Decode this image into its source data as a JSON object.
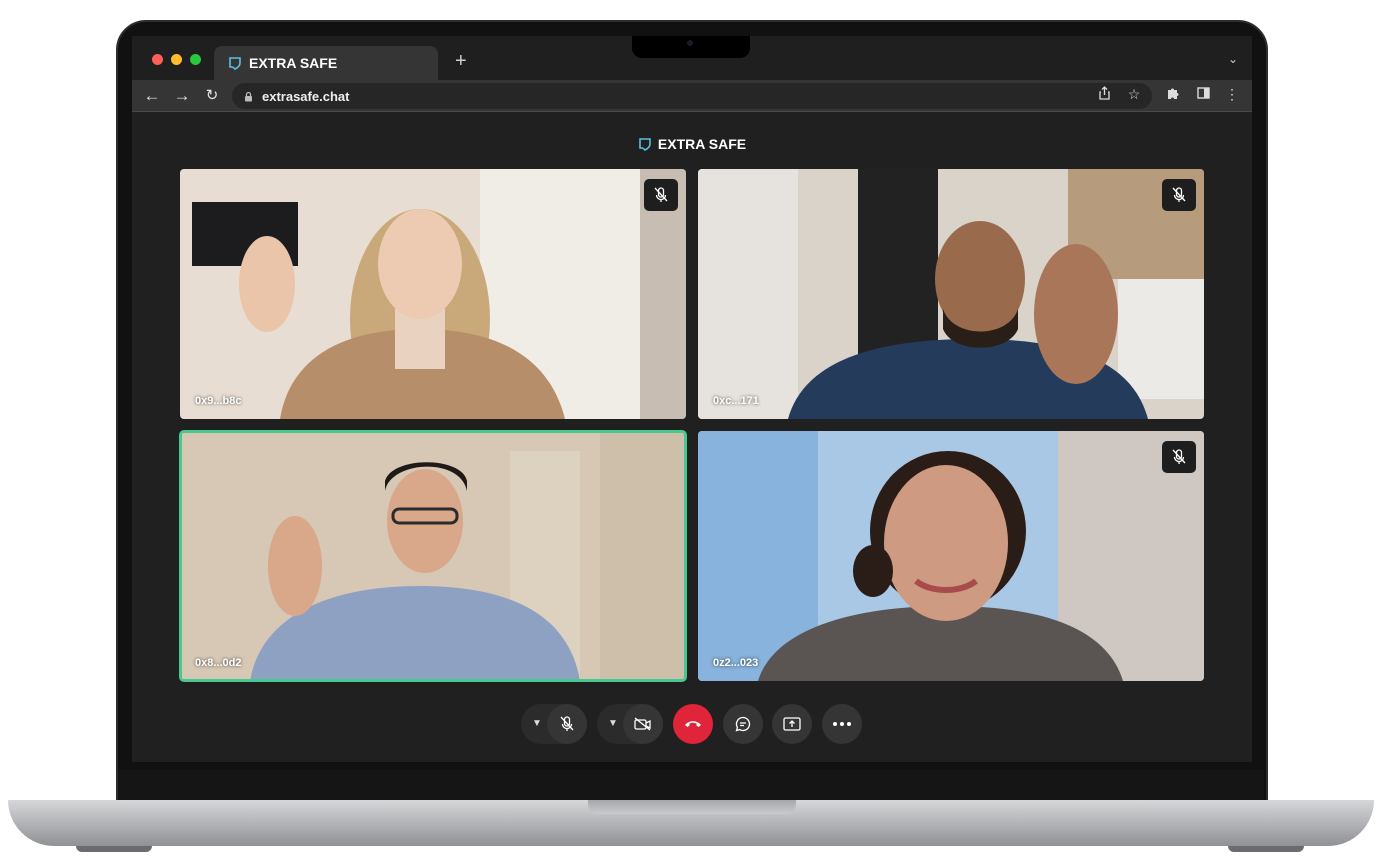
{
  "browser": {
    "tab_title": "EXTRA SAFE",
    "url": "extrasafe.chat"
  },
  "app": {
    "brand": "EXTRA SAFE",
    "accent_color": "#47c88e",
    "hangup_color": "#e0253b"
  },
  "participants": [
    {
      "name": "0x9...b8c",
      "muted": true,
      "active": false
    },
    {
      "name": "0xc...171",
      "muted": true,
      "active": false
    },
    {
      "name": "0x8...0d2",
      "muted": false,
      "active": true
    },
    {
      "name": "0z2...023",
      "muted": true,
      "active": false
    }
  ],
  "controls": [
    "mic-options",
    "microphone",
    "camera-options",
    "camera",
    "hang-up",
    "chat",
    "share-screen",
    "more"
  ]
}
